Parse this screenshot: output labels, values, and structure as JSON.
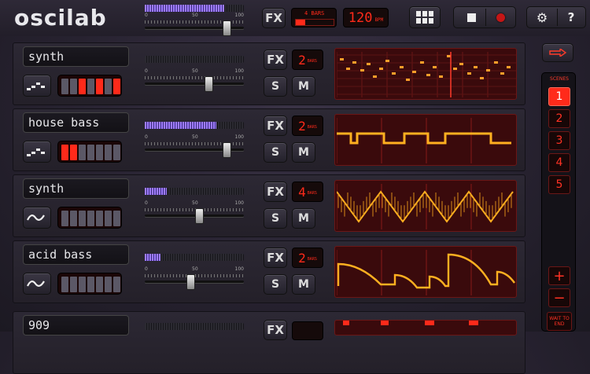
{
  "app": {
    "logo": "oscilab"
  },
  "topbar": {
    "fx": "FX",
    "bars_value": "4",
    "bars_unit": "BARS",
    "tempo": "120",
    "tempo_unit": "BPM",
    "master_level": 0.8,
    "master_volume": 0.85,
    "slider_marks": [
      "0",
      "50",
      "100"
    ],
    "stop_icon": "stop-icon",
    "record_icon": "record-icon",
    "grid_icon": "grid-icon",
    "settings_icon": "gear-icon",
    "help": "?"
  },
  "tracks": [
    {
      "name": "synth",
      "fx": "FX",
      "bars": "2",
      "unit": "BARS",
      "solo": "S",
      "mute": "M",
      "level": 0.0,
      "volume": 0.65,
      "wave_icon": "arpeggio-icon",
      "keys_lit": [
        2,
        4,
        6
      ]
    },
    {
      "name": "house bass",
      "fx": "FX",
      "bars": "2",
      "unit": "BARS",
      "solo": "S",
      "mute": "M",
      "level": 0.72,
      "volume": 0.85,
      "wave_icon": "arpeggio-icon",
      "keys_lit": [
        0,
        1
      ]
    },
    {
      "name": "synth",
      "fx": "FX",
      "bars": "4",
      "unit": "BARS",
      "solo": "S",
      "mute": "M",
      "level": 0.22,
      "volume": 0.55,
      "wave_icon": "sine-icon",
      "keys_lit": []
    },
    {
      "name": "acid bass",
      "fx": "FX",
      "bars": "2",
      "unit": "BARS",
      "solo": "S",
      "mute": "M",
      "level": 0.16,
      "volume": 0.45,
      "wave_icon": "sine-icon",
      "keys_lit": []
    },
    {
      "name": "909",
      "fx": "FX",
      "bars": "",
      "unit": "",
      "solo": "",
      "mute": "",
      "level": 0.0,
      "volume": 0.0,
      "wave_icon": "",
      "keys_lit": []
    }
  ],
  "slider_marks": [
    "0",
    "50",
    "100"
  ],
  "scenes": {
    "label": "SCENES",
    "items": [
      "1",
      "2",
      "3",
      "4",
      "5"
    ],
    "active": "1",
    "add": "+",
    "remove": "−",
    "wait_to_end": "WAIT TO END"
  },
  "colors": {
    "accent": "#ff2a1a",
    "meter": "#9f7cff",
    "pattern_bg": "#3a0a0c",
    "wave": "#ffb020"
  }
}
